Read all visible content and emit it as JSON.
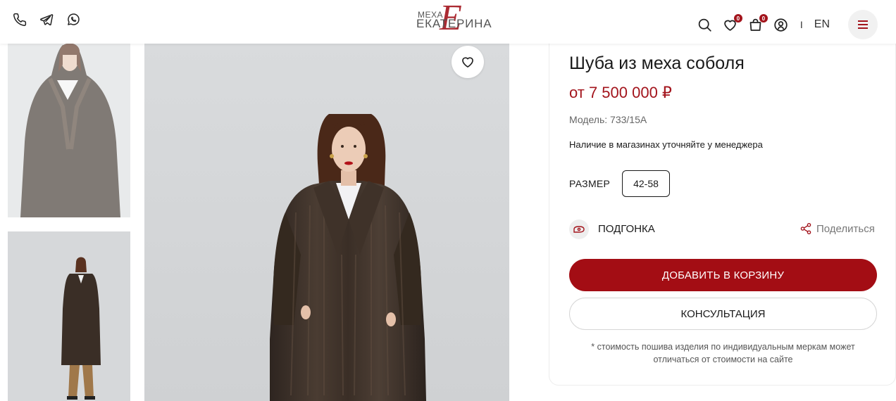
{
  "header": {
    "logo_small": "МЕХА",
    "logo_main": "ЕКАТЕРИНА",
    "logo_monogram": "Е",
    "wishlist_count": "0",
    "cart_count": "0",
    "separator": "I",
    "language": "EN"
  },
  "product": {
    "title": "Шуба из меха соболя",
    "price": "от 7 500 000 ₽",
    "model": "Модель: 733/15А",
    "availability": "Наличие в магазинах уточняйте у менеджера",
    "size_label": "РАЗМЕР",
    "size_value": "42-58",
    "fitting_label": "ПОДГОНКА",
    "share_label": "Поделиться",
    "add_to_cart": "ДОБАВИТЬ В КОРЗИНУ",
    "consultation": "КОНСУЛЬТАЦИЯ",
    "note": "* стоимость пошива изделия по индивидуальным меркам может отличаться от стоимости на сайте"
  },
  "colors": {
    "accent": "#a30d14",
    "price": "#a3141c",
    "coat": "#3a2e26"
  },
  "icons": [
    "phone-icon",
    "telegram-icon",
    "whatsapp-icon",
    "search-icon",
    "heart-icon",
    "cart-icon",
    "user-icon",
    "menu-icon",
    "favorite-icon",
    "ruler-icon",
    "share-icon"
  ]
}
